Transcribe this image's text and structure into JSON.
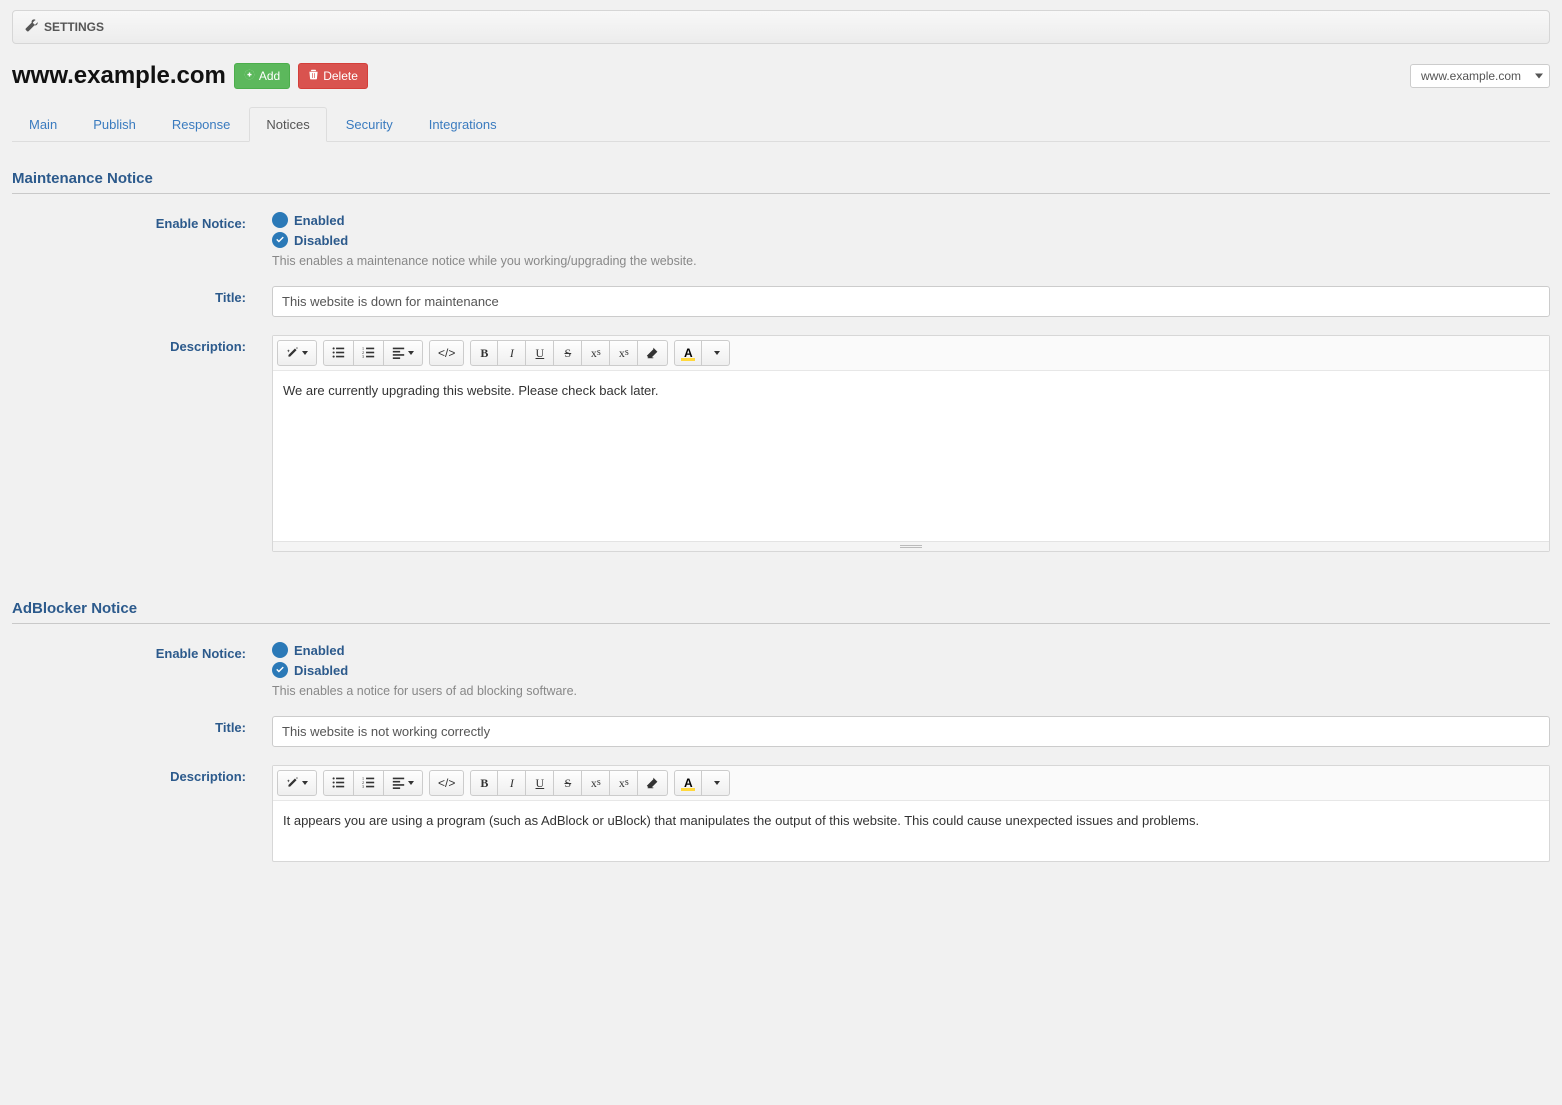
{
  "panel": {
    "title": "SETTINGS"
  },
  "header": {
    "site_name": "www.example.com",
    "add_label": "Add",
    "delete_label": "Delete",
    "selector_value": "www.example.com"
  },
  "tabs": {
    "items": [
      {
        "label": "Main"
      },
      {
        "label": "Publish"
      },
      {
        "label": "Response"
      },
      {
        "label": "Notices"
      },
      {
        "label": "Security"
      },
      {
        "label": "Integrations"
      }
    ],
    "active_index": 3
  },
  "maintenance": {
    "section_title": "Maintenance Notice",
    "enable_label": "Enable Notice:",
    "enabled_label": "Enabled",
    "disabled_label": "Disabled",
    "help": "This enables a maintenance notice while you working/upgrading the website.",
    "title_label": "Title:",
    "title_value": "This website is down for maintenance",
    "description_label": "Description:",
    "description_value": "We are currently upgrading this website. Please check back later."
  },
  "adblocker": {
    "section_title": "AdBlocker Notice",
    "enable_label": "Enable Notice:",
    "enabled_label": "Enabled",
    "disabled_label": "Disabled",
    "help": "This enables a notice for users of ad blocking software.",
    "title_label": "Title:",
    "title_value": "This website is not working correctly",
    "description_label": "Description:",
    "description_value": "It appears you are using a program (such as AdBlock or uBlock) that manipulates the output of this website. This could cause unexpected issues and problems."
  },
  "toolbar_labels": {
    "code": "</>",
    "bold": "B",
    "italic": "I",
    "underline": "U",
    "strike": "S",
    "sup_x": "x",
    "sup_s": "s",
    "sub_x": "x",
    "sub_s": "s",
    "color_a": "A"
  }
}
